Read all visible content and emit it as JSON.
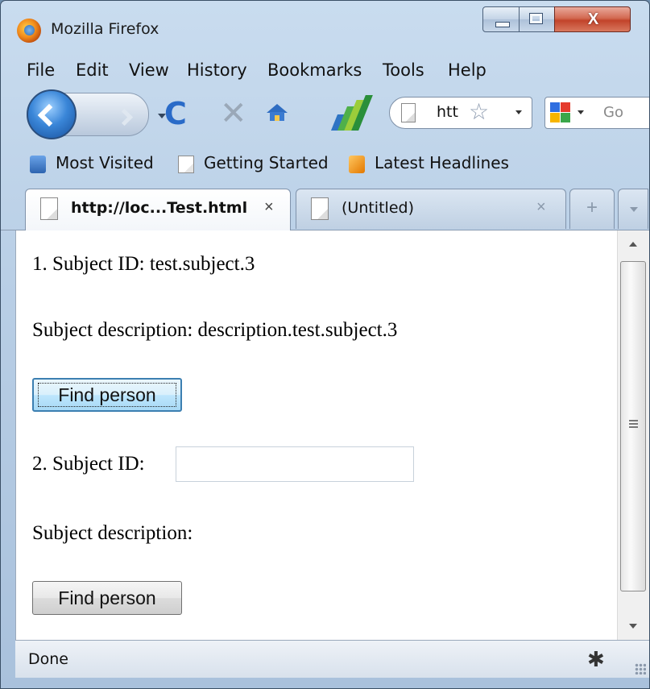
{
  "window": {
    "title": "Mozilla Firefox"
  },
  "window_controls": {
    "close_glyph": "X"
  },
  "menu": {
    "items": [
      "File",
      "Edit",
      "View",
      "History",
      "Bookmarks",
      "Tools",
      "Help"
    ]
  },
  "nav": {
    "reload_glyph": "C",
    "stop_glyph": "✕",
    "url_text": "htt",
    "star_glyph": "☆",
    "search_placeholder": "Go"
  },
  "bookmarks": {
    "items": [
      "Most Visited",
      "Getting Started",
      "Latest Headlines"
    ]
  },
  "tabs": [
    {
      "label": "http://loc...Test.html",
      "close": "×"
    },
    {
      "label": "(Untitled)",
      "close": "×"
    }
  ],
  "tab_new_glyph": "+",
  "content": {
    "subject1": {
      "id_line": "1. Subject ID: test.subject.3",
      "desc_line": "Subject description: description.test.subject.3",
      "button": "Find person"
    },
    "subject2": {
      "id_label": "2. Subject ID:",
      "id_value": "",
      "desc_line": "Subject description:",
      "button": "Find person"
    }
  },
  "status": {
    "text": "Done"
  },
  "colors": {
    "accent": "#2a6bc8",
    "close": "#c2432a",
    "focus": "#3c7fb1"
  }
}
